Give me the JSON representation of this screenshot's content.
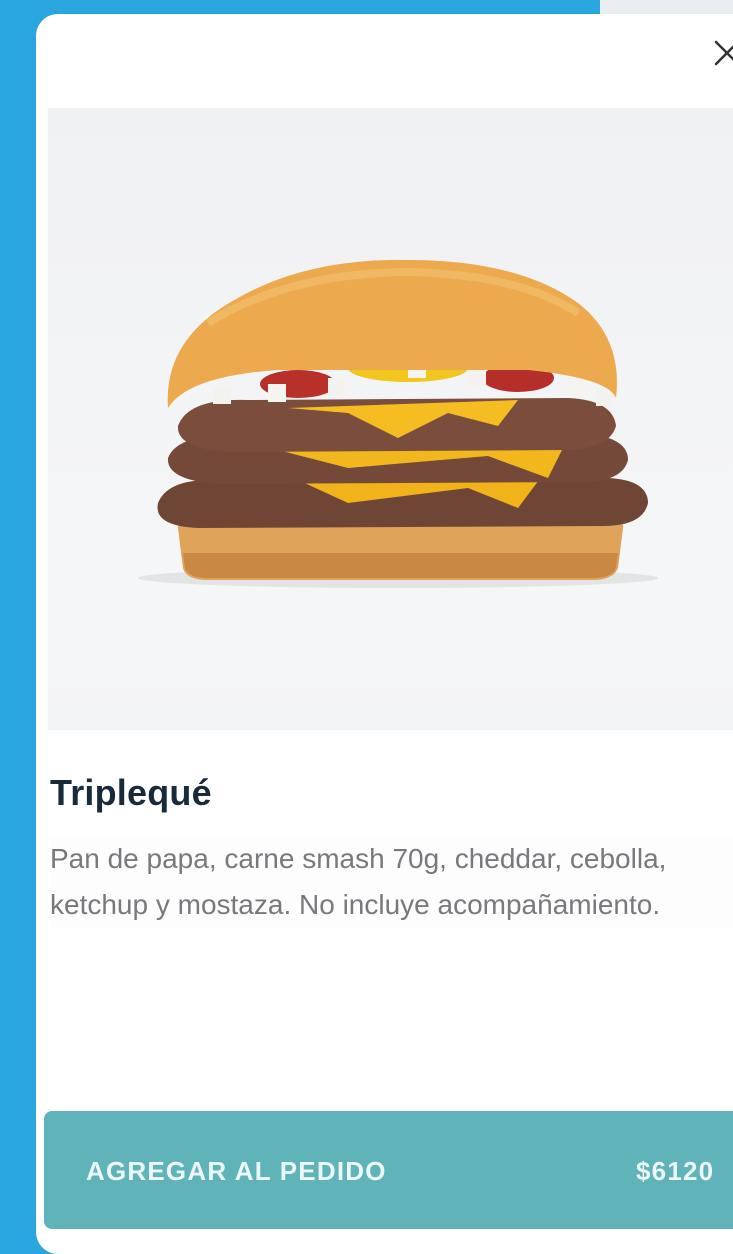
{
  "product": {
    "name": "Triplequé",
    "description": "Pan de papa, carne smash 70g, cheddar, cebolla, ketchup y mostaza. No incluye acompañamiento.",
    "image_icon": "burger-photo"
  },
  "modal": {
    "close_icon": "close-icon"
  },
  "footer": {
    "add_label": "AGREGAR AL PEDIDO",
    "price": "$6120"
  },
  "colors": {
    "backdrop": "#2aa6df",
    "button": "#5fb3b9",
    "title": "#1b2a3a",
    "description": "#77797c"
  }
}
